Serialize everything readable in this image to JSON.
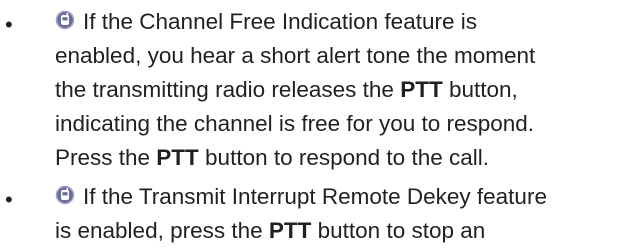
{
  "bullet_char": "•",
  "icon": "radio-feature-icon",
  "colors": {
    "icon_fill": "#6b6d9c",
    "text": "#231f20"
  },
  "items": [
    {
      "lines": [
        {
          "pre": "If the Channel Free Indication feature is",
          "bold": "",
          "post": ""
        },
        {
          "pre": "enabled, you hear a short alert tone the moment",
          "bold": "",
          "post": ""
        },
        {
          "pre": "the transmitting radio releases the ",
          "bold": "PTT",
          "post": " button,"
        },
        {
          "pre": "indicating the channel is free for you to respond.",
          "bold": "",
          "post": ""
        },
        {
          "pre": "Press the ",
          "bold": "PTT",
          "post": " button to respond to the call."
        }
      ]
    },
    {
      "lines": [
        {
          "pre": "If the Transmit Interrupt Remote Dekey feature",
          "bold": "",
          "post": ""
        },
        {
          "pre": "is enabled, press the ",
          "bold": "PTT",
          "post": " button to stop an"
        }
      ]
    }
  ]
}
